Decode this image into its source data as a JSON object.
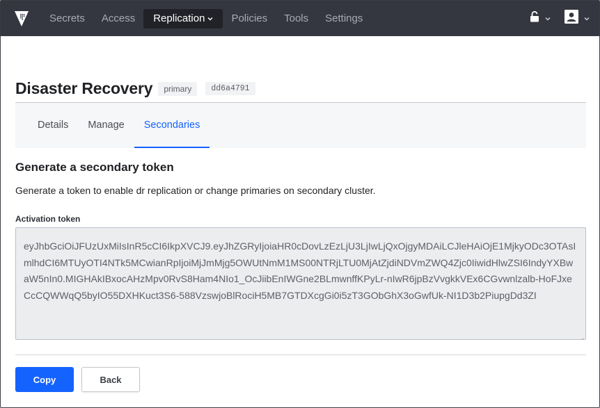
{
  "nav": {
    "items": [
      {
        "label": "Secrets"
      },
      {
        "label": "Access"
      },
      {
        "label": "Replication",
        "active": true
      },
      {
        "label": "Policies"
      },
      {
        "label": "Tools"
      },
      {
        "label": "Settings"
      }
    ],
    "caret": "⌄",
    "right_icons": [
      "unlocked-lock-icon",
      "user-icon"
    ]
  },
  "header": {
    "title": "Disaster Recovery",
    "mode_tag": "primary",
    "id_tag": "dd6a4791"
  },
  "tabs": [
    {
      "label": "Details"
    },
    {
      "label": "Manage"
    },
    {
      "label": "Secondaries",
      "active": true
    }
  ],
  "section": {
    "title": "Generate a secondary token",
    "description": "Generate a token to enable dr replication or change primaries on secondary cluster."
  },
  "token": {
    "label": "Activation token",
    "value": "eyJhbGciOiJFUzUxMiIsInR5cCI6IkpXVCJ9.eyJhZGRyIjoiaHR0cDovLzEzLjU3LjIwLjQxOjgyMDAiLCJleHAiOjE1MjkyODc3OTAsImlhdCI6MTUyOTI4NTk5MCwianRpIjoiMjJmMjg5OWUtNmM1MS00NTRjLTU0MjAtZjdiNDVmZWQ4Zjc0IiwidHlwZSI6IndyYXBwaW5nIn0.MIGHAkIBxocAHzMpv0RvS8Ham4NIo1_OcJiibEnIWGne2BLmwnffKPyLr-nIwR6jpBzVvgkkVEx6CGvwnlzalb-HoFJxeCcCQWWqQ5byIO55DXHKuct3S6-588VzswjoBlRociH5MB7GTDXcgGi0i5zT3GObGhX3oGwfUk-NI1D3b2PiupgDd3ZI"
  },
  "actions": {
    "copy_label": "Copy",
    "back_label": "Back"
  },
  "colors": {
    "nav_bg": "#343740",
    "accent": "#1563ff"
  }
}
